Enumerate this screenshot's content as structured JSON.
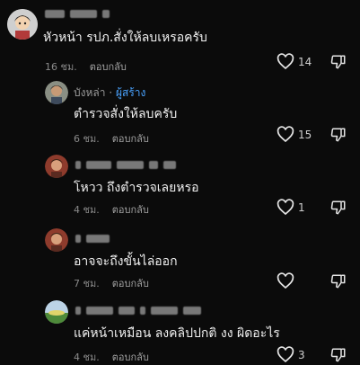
{
  "comments": [
    {
      "username": "",
      "text": "หัวหน้า รปภ.สั่งให้ลบเหรอครับ",
      "time": "16 ชม.",
      "reply_label": "ตอบกลับ",
      "likes": "14"
    },
    {
      "username": "บังหล่า",
      "author_badge": "ผู้สร้าง",
      "separator": "·",
      "text": "ตำรวจสั่งให้ลบครับ",
      "time": "6 ชม.",
      "reply_label": "ตอบกลับ",
      "likes": "15"
    },
    {
      "username": "",
      "text": "โหวว ถึงตำรวจเลยหรอ",
      "time": "4 ชม.",
      "reply_label": "ตอบกลับ",
      "likes": "1"
    },
    {
      "username": "",
      "text": "อาจจะถึงขั้นไล่ออก",
      "time": "7 ชม.",
      "reply_label": "ตอบกลับ",
      "likes": ""
    },
    {
      "username": "",
      "text": "แค่หน้าเหมือน ลงคลิปปกติ งง ผิดอะไร",
      "time": "4 ชม.",
      "reply_label": "ตอบกลับ",
      "likes": "3"
    }
  ],
  "icons": {
    "like": "heart-outline-icon",
    "dislike": "thumbs-down-icon"
  },
  "colors": {
    "background": "#0b0b0b",
    "creator_badge": "#4aa3ff"
  }
}
